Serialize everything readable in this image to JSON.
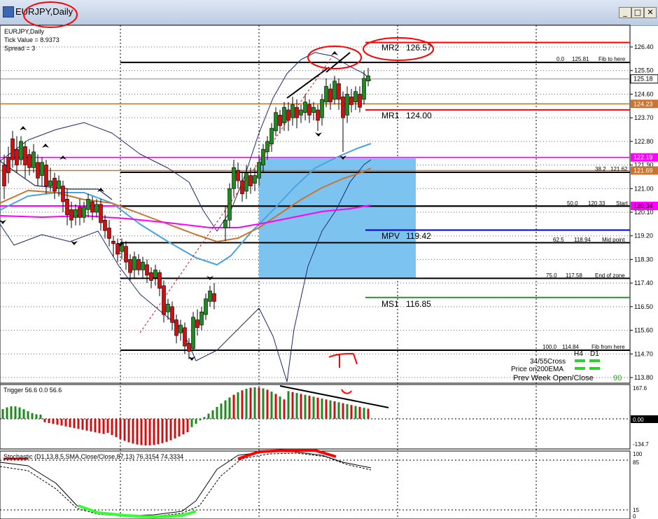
{
  "window": {
    "title": "EURJPY,Daily",
    "minimize": "_",
    "maximize": "□",
    "close": "✕"
  },
  "chart_info": {
    "symbol_line": "EURJPY,Daily",
    "tick_value": "Tick Value = 8.9373",
    "spread": "Spread = 3"
  },
  "pivots": [
    {
      "label": "MR2",
      "value": "126.57",
      "price": 126.57,
      "color": "#ff0000"
    },
    {
      "label": "MR1",
      "value": "124.00",
      "price": 124.0,
      "color": "#ff0000"
    },
    {
      "label": "MPV",
      "value": "119.42",
      "price": 119.42,
      "color": "#0000c0"
    },
    {
      "label": "MS1",
      "value": "116.85",
      "price": 116.85,
      "color": "#2f8f2f"
    }
  ],
  "fib_levels": [
    {
      "pct": "0.0",
      "price": "125.81",
      "note": "Fib to here",
      "p": 125.81
    },
    {
      "pct": "38.2",
      "price": "121.62",
      "note": "",
      "p": 121.62
    },
    {
      "pct": "50.0",
      "price": "120.33",
      "note": "Start",
      "p": 120.33
    },
    {
      "pct": "62.5",
      "price": "118.94",
      "note": "Mid point",
      "p": 118.94
    },
    {
      "pct": "75.0",
      "price": "117.58",
      "note": "End of zone",
      "p": 117.58
    },
    {
      "pct": "100.0",
      "price": "114.84",
      "note": "Fib from here",
      "p": 114.84
    }
  ],
  "price_axis": {
    "ticks": [
      "126.40",
      "125.50",
      "124.60",
      "123.70",
      "122.80",
      "121.90",
      "121.00",
      "120.10",
      "119.20",
      "118.30",
      "117.40",
      "116.50",
      "115.60",
      "114.70",
      "113.80"
    ],
    "markers": [
      {
        "label": "125.18",
        "p": 125.18,
        "bg": "#ffffff",
        "fg": "#000000"
      },
      {
        "label": "124.23",
        "p": 124.23,
        "bg": "#c87533",
        "fg": "#ffffff"
      },
      {
        "label": "122.19",
        "p": 122.19,
        "bg": "#ff00ff",
        "fg": "#ffffff"
      },
      {
        "label": "121.69",
        "p": 121.69,
        "bg": "#c87533",
        "fg": "#ffffff"
      },
      {
        "label": "120.34",
        "p": 120.34,
        "bg": "#ff00ff",
        "fg": "#000000"
      }
    ]
  },
  "info_panel": {
    "h4": "H4",
    "d1": "D1",
    "cross": "34/55Cross",
    "ema": "Price on200EMA",
    "prev_week": "Prev Week Open/Close",
    "prev_week_value": "90"
  },
  "trigger": {
    "header": "Trigger 56.6 0.0 56.6",
    "ticks": [
      "167.6",
      "0.00",
      "-134.7"
    ]
  },
  "stochastic": {
    "header": "Stochastic (D1,13,8,5,SMA,Close/Close,87,13) 76.3154 74.3334",
    "ticks": [
      "100",
      "85",
      "15",
      "0"
    ]
  },
  "colors": {
    "bull": "#1f8a1f",
    "bear": "#d01010",
    "accent_red": "#ff0000",
    "zone": "#7dc3f0"
  }
}
